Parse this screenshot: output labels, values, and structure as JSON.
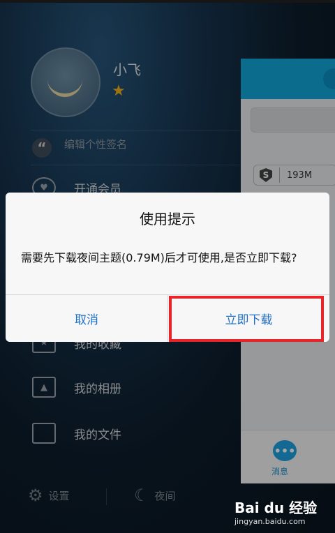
{
  "drawer": {
    "username": "小飞",
    "signature_placeholder": "编辑个性签名",
    "items": [
      {
        "label": "开通会员",
        "icon": "vip-icon"
      },
      {
        "label": "我的收藏",
        "icon": "bookmark-icon"
      },
      {
        "label": "我的相册",
        "icon": "photo-icon"
      },
      {
        "label": "我的文件",
        "icon": "folder-icon"
      }
    ],
    "bottom": {
      "settings_label": "设置",
      "night_label": "夜间"
    }
  },
  "main": {
    "storage_chip": {
      "value": "193M"
    },
    "tab_messages": "消息"
  },
  "dialog": {
    "title": "使用提示",
    "message": "需要先下载夜间主题(0.79M)后才可使用,是否立即下载?",
    "cancel_label": "取消",
    "confirm_label": "立即下载"
  },
  "watermark": {
    "brand": "Bai du 经验",
    "url": "jingyan.baidu.com"
  },
  "colors": {
    "accent_blue": "#12a6db",
    "button_text": "#1f6fc7",
    "highlight_red": "#e8232a",
    "star": "#f2b318"
  }
}
